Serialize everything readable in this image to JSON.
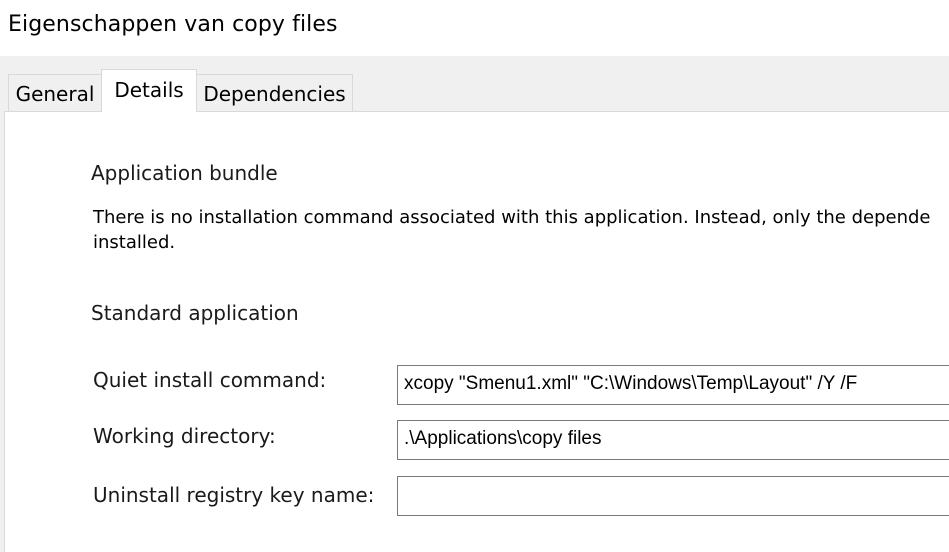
{
  "window": {
    "title": "Eigenschappen van copy files"
  },
  "tabs": [
    {
      "label": "General",
      "selected": false
    },
    {
      "label": "Details",
      "selected": true
    },
    {
      "label": "Dependencies",
      "selected": false
    }
  ],
  "options": {
    "bundle": {
      "label": "Application bundle",
      "checked": false,
      "description_line1": "There is no installation command associated with this application.  Instead, only the depende",
      "description_line2": "installed."
    },
    "standard": {
      "label": "Standard application",
      "checked": true
    }
  },
  "fields": {
    "quiet_install": {
      "label": "Quiet install command:",
      "value": "xcopy \"Smenu1.xml\" \"C:\\Windows\\Temp\\Layout\" /Y /F"
    },
    "working_directory": {
      "label": "Working directory:",
      "value": ".\\Applications\\copy files"
    },
    "uninstall_key": {
      "label": "Uninstall registry key name:",
      "value": ""
    }
  }
}
